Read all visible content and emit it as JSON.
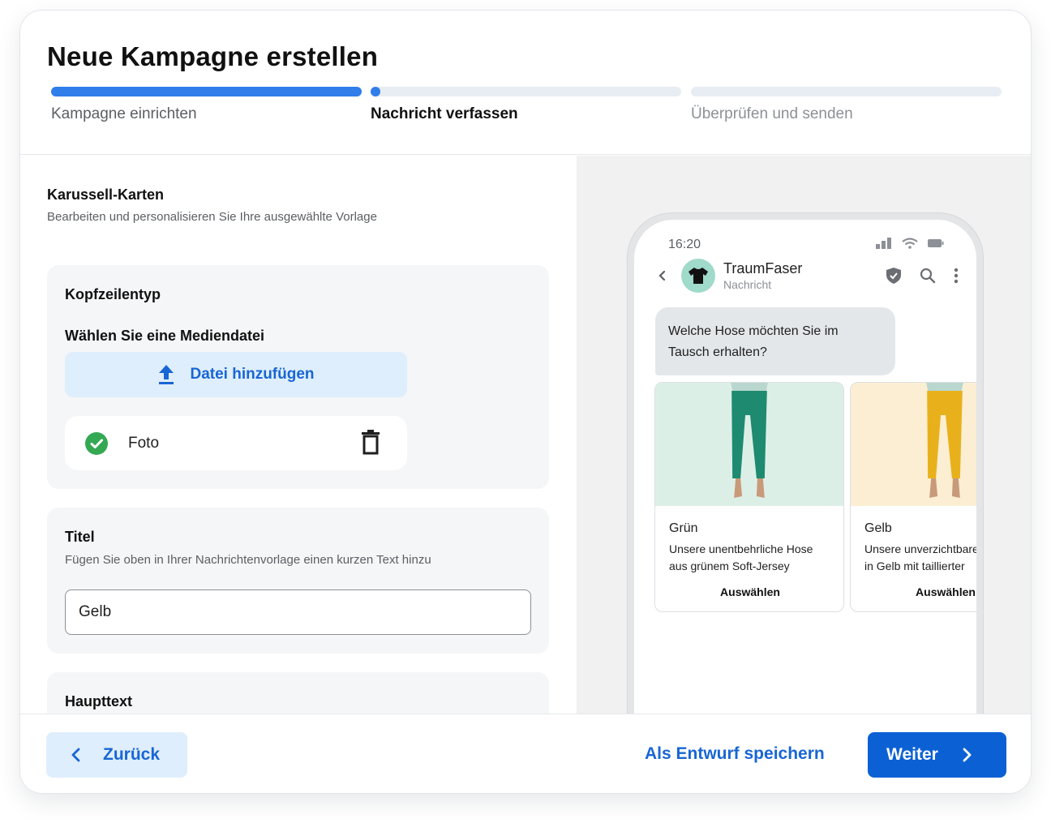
{
  "header": {
    "title": "Neue Kampagne erstellen",
    "steps": [
      {
        "label": "Kampagne einrichten",
        "progress": 1.0
      },
      {
        "label": "Nachricht verfassen",
        "progress": 0.0
      },
      {
        "label": "Überprüfen und senden",
        "progress": 0.0
      }
    ]
  },
  "editor": {
    "section_title": "Karussell-Karten",
    "section_subtitle": "Bearbeiten und personalisieren Sie Ihre ausgewählte Vorlage",
    "header_panel": {
      "label": "Kopfzeilentyp",
      "media_label": "Wählen Sie eine Mediendatei",
      "upload_button": "Datei hinzufügen",
      "file_name": "Foto"
    },
    "title_panel": {
      "label": "Titel",
      "description": "Fügen Sie oben in Ihrer Nachrichtenvorlage einen kurzen Text hinzu",
      "value": "Gelb"
    },
    "body_panel": {
      "label": "Haupttext"
    }
  },
  "preview": {
    "time": "16:20",
    "business_name": "TraumFaser",
    "business_subtitle": "Nachricht",
    "message": "Welche Hose möchten Sie im Tausch erhalten?",
    "cards": [
      {
        "title": "Grün",
        "line1": "Unsere unentbehrliche Hose",
        "line2": "aus grünem Soft-Jersey",
        "button": "Auswählen",
        "bg": "#dcefe7",
        "pants": "#1e8a70"
      },
      {
        "title": "Gelb",
        "line1": "Unsere unverzichtbare Hose",
        "line2": "in Gelb mit taillierter",
        "button": "Auswählen",
        "bg": "#fbeed2",
        "pants": "#e8b11c"
      }
    ]
  },
  "footer": {
    "back_label": "Zurück",
    "draft_label": "Als Entwurf speichern",
    "next_label": "Weiter"
  },
  "colors": {
    "accent": "#2f7ee9",
    "primary_button": "#0b61d4",
    "success": "#34a853"
  }
}
